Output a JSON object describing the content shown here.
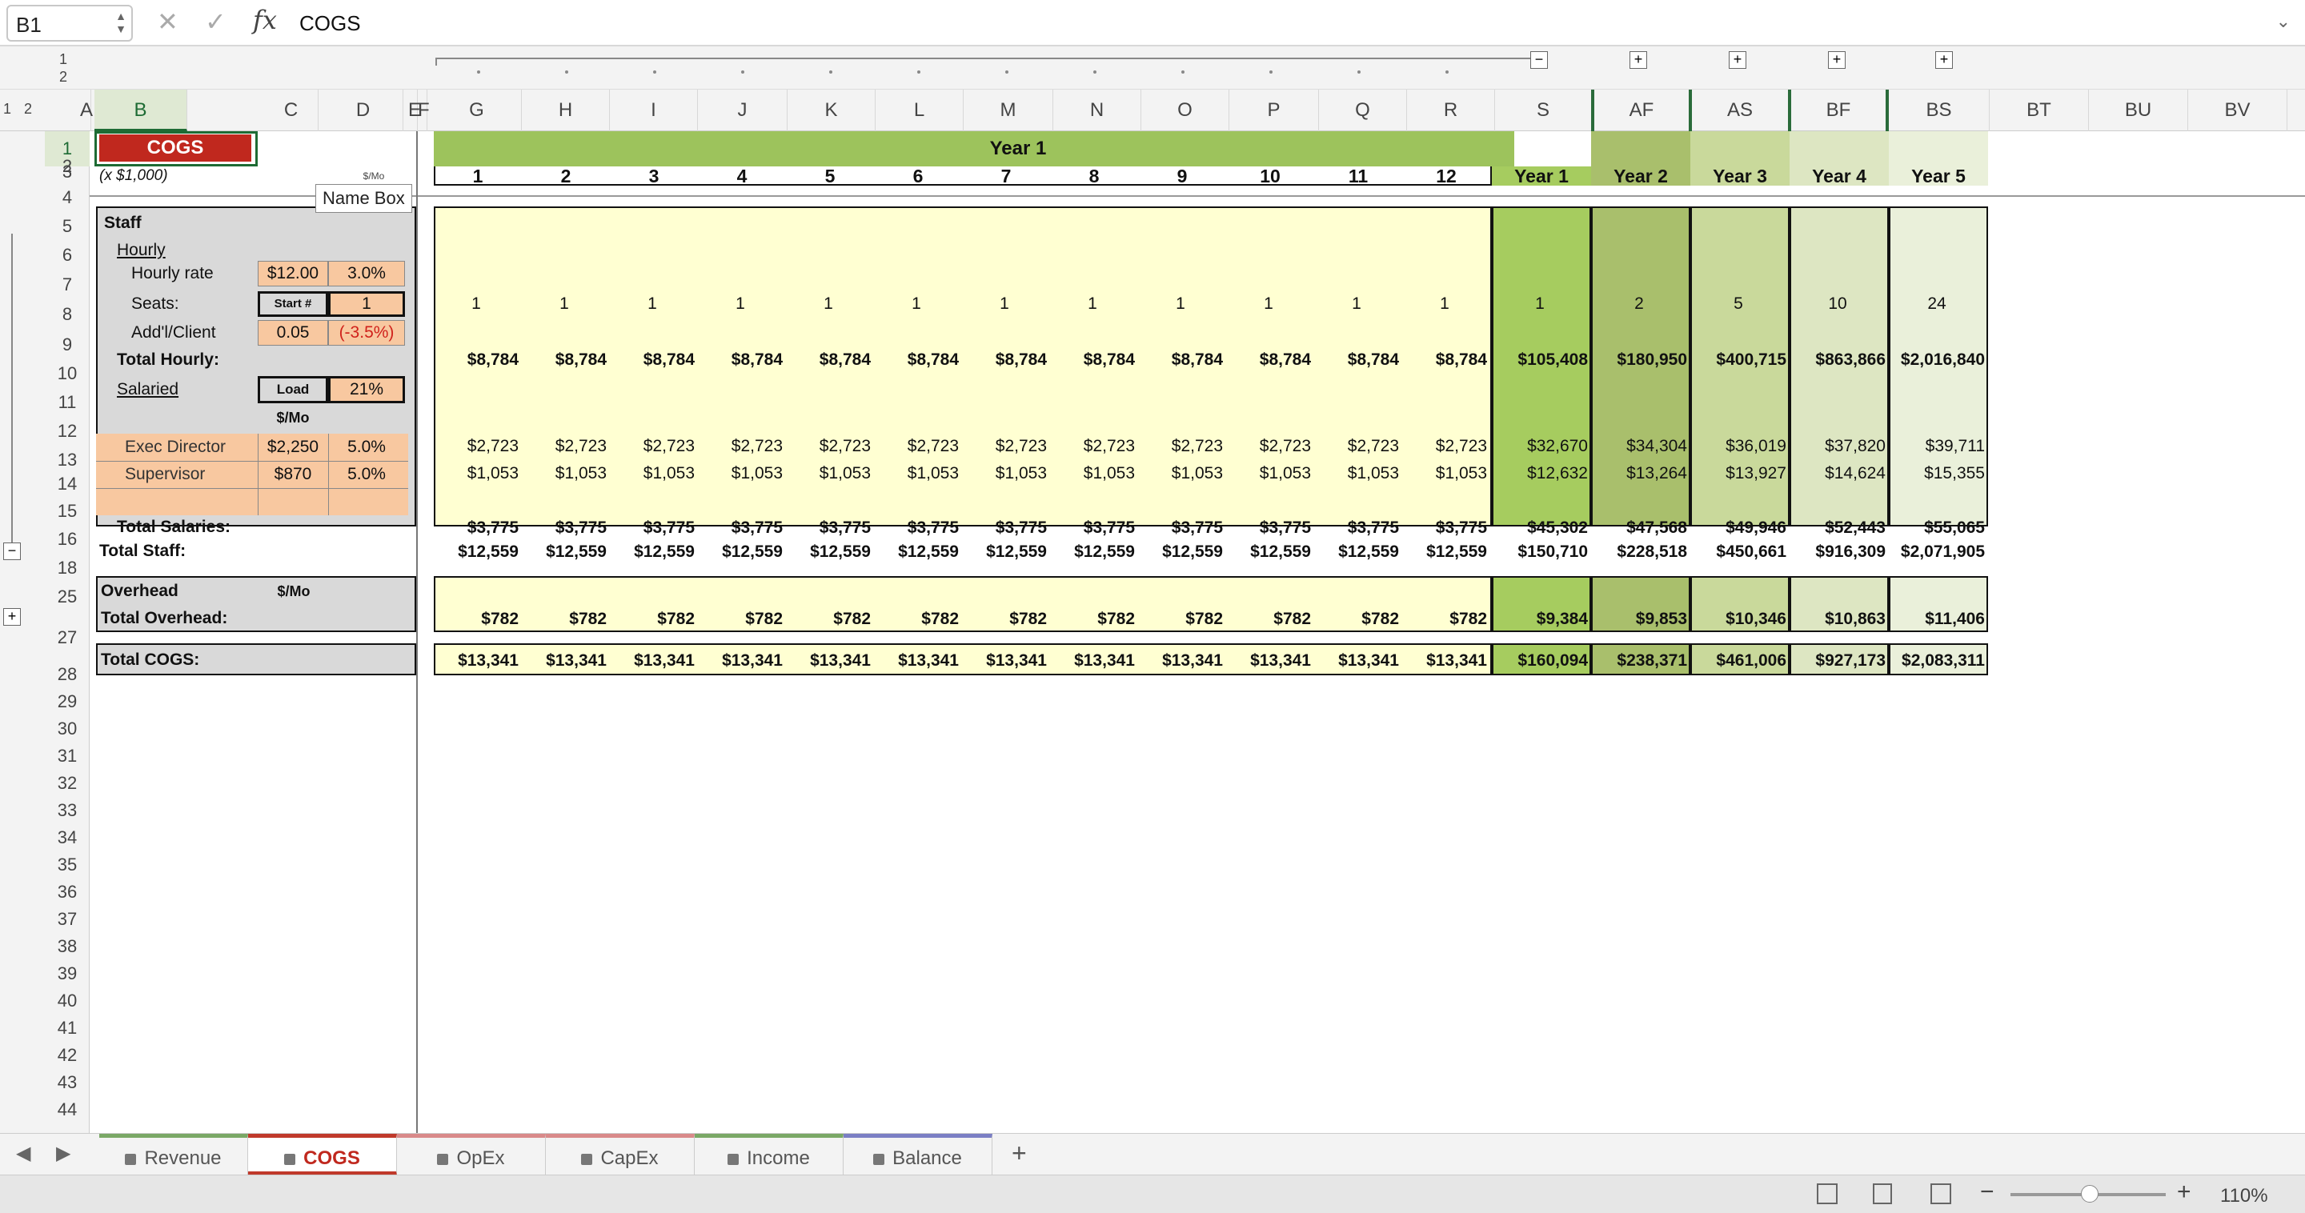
{
  "formula_bar": {
    "name_box": "B1",
    "content": "COGS",
    "fx": "fx",
    "cancel": "✕",
    "enter": "✓"
  },
  "tooltip": "Name Box",
  "outline_levels": [
    "1",
    "2"
  ],
  "col_letters": [
    "A",
    "B",
    "C",
    "D",
    "E",
    "F",
    "G",
    "H",
    "I",
    "J",
    "K",
    "L",
    "M",
    "N",
    "O",
    "P",
    "Q",
    "R",
    "S",
    "AF",
    "AS",
    "BF",
    "BS",
    "BT",
    "BU",
    "BV"
  ],
  "row_numbers": [
    "1",
    "2",
    "3",
    "4",
    "5",
    "6",
    "7",
    "8",
    "9",
    "10",
    "11",
    "12",
    "13",
    "14",
    "15",
    "16",
    "18",
    "25",
    "27",
    "28",
    "29",
    "30",
    "31",
    "32",
    "33",
    "34",
    "35",
    "36",
    "37",
    "38",
    "39",
    "40",
    "41",
    "42",
    "43",
    "44"
  ],
  "sheet": {
    "title": "COGS",
    "units": "(x $1,000)",
    "hidden_label": "$/Mo",
    "year_header": "Year 1",
    "months": [
      "1",
      "2",
      "3",
      "4",
      "5",
      "6",
      "7",
      "8",
      "9",
      "10",
      "11",
      "12"
    ],
    "years": [
      "Year 1",
      "Year 2",
      "Year 3",
      "Year 4",
      "Year 5"
    ],
    "staff": "Staff",
    "hourly": "Hourly",
    "hourly_rate": "Hourly rate",
    "hourly_rate_val": "$12.00",
    "hourly_rate_pct": "3.0%",
    "seats": "Seats:",
    "start_label": "Start #",
    "start_val": "1",
    "addl": "Add'l/Client",
    "addl_val": "0.05",
    "addl_pct": "(-3.5%)",
    "total_hourly": "Total Hourly:",
    "salaried": "Salaried",
    "load_label": "Load",
    "load_val": "21%",
    "per_mo": "$/Mo",
    "exec": "Exec Director",
    "exec_val": "$2,250",
    "exec_pct": "5.0%",
    "sup": "Supervisor",
    "sup_val": "$870",
    "sup_pct": "5.0%",
    "total_salaries": "Total Salaries:",
    "total_staff": "Total Staff:",
    "overhead": "Overhead",
    "overhead_mo": "$/Mo",
    "total_overhead": "Total Overhead:",
    "total_cogs": "Total COGS:"
  },
  "rows": {
    "seats": {
      "months": [
        "1",
        "1",
        "1",
        "1",
        "1",
        "1",
        "1",
        "1",
        "1",
        "1",
        "1",
        "1"
      ],
      "years": [
        "1",
        "2",
        "5",
        "10",
        "24"
      ]
    },
    "total_hourly": {
      "months": [
        "$8,784",
        "$8,784",
        "$8,784",
        "$8,784",
        "$8,784",
        "$8,784",
        "$8,784",
        "$8,784",
        "$8,784",
        "$8,784",
        "$8,784",
        "$8,784"
      ],
      "years": [
        "$105,408",
        "$180,950",
        "$400,715",
        "$863,866",
        "$2,016,840"
      ]
    },
    "exec": {
      "months": [
        "$2,723",
        "$2,723",
        "$2,723",
        "$2,723",
        "$2,723",
        "$2,723",
        "$2,723",
        "$2,723",
        "$2,723",
        "$2,723",
        "$2,723",
        "$2,723"
      ],
      "years": [
        "$32,670",
        "$34,304",
        "$36,019",
        "$37,820",
        "$39,711"
      ]
    },
    "sup": {
      "months": [
        "$1,053",
        "$1,053",
        "$1,053",
        "$1,053",
        "$1,053",
        "$1,053",
        "$1,053",
        "$1,053",
        "$1,053",
        "$1,053",
        "$1,053",
        "$1,053"
      ],
      "years": [
        "$12,632",
        "$13,264",
        "$13,927",
        "$14,624",
        "$15,355"
      ]
    },
    "total_salaries": {
      "months": [
        "$3,775",
        "$3,775",
        "$3,775",
        "$3,775",
        "$3,775",
        "$3,775",
        "$3,775",
        "$3,775",
        "$3,775",
        "$3,775",
        "$3,775",
        "$3,775"
      ],
      "years": [
        "$45,302",
        "$47,568",
        "$49,946",
        "$52,443",
        "$55,065"
      ]
    },
    "total_staff": {
      "months": [
        "$12,559",
        "$12,559",
        "$12,559",
        "$12,559",
        "$12,559",
        "$12,559",
        "$12,559",
        "$12,559",
        "$12,559",
        "$12,559",
        "$12,559",
        "$12,559"
      ],
      "years": [
        "$150,710",
        "$228,518",
        "$450,661",
        "$916,309",
        "$2,071,905"
      ]
    },
    "total_overhead": {
      "months": [
        "$782",
        "$782",
        "$782",
        "$782",
        "$782",
        "$782",
        "$782",
        "$782",
        "$782",
        "$782",
        "$782",
        "$782"
      ],
      "years": [
        "$9,384",
        "$9,853",
        "$10,346",
        "$10,863",
        "$11,406"
      ]
    },
    "total_cogs": {
      "months": [
        "$13,341",
        "$13,341",
        "$13,341",
        "$13,341",
        "$13,341",
        "$13,341",
        "$13,341",
        "$13,341",
        "$13,341",
        "$13,341",
        "$13,341",
        "$13,341"
      ],
      "years": [
        "$160,094",
        "$238,371",
        "$461,006",
        "$927,173",
        "$2,083,311"
      ]
    }
  },
  "tabs": [
    {
      "label": "Revenue",
      "color": "#7aa866"
    },
    {
      "label": "COGS",
      "color": "#c0392b"
    },
    {
      "label": "OpEx",
      "color": "#d98a8a"
    },
    {
      "label": "CapEx",
      "color": "#d98a8a"
    },
    {
      "label": "Income",
      "color": "#7aa866"
    },
    {
      "label": "Balance",
      "color": "#7b7fc4"
    }
  ],
  "add_tab": "+",
  "status": {
    "zoom": "110%",
    "minus": "−",
    "plus": "+"
  },
  "colors": {
    "green_dark": "#9dc35c",
    "green_y1": "#a6cc5f",
    "green_y2": "#a9bf6c",
    "green_y3": "#c9d99b",
    "green_y4": "#dde6c2",
    "green_y5": "#eaf0da",
    "cream": "#ffffd2",
    "orange": "#f8c8a0",
    "gray": "#d9d9d9",
    "red": "#c0281e"
  }
}
